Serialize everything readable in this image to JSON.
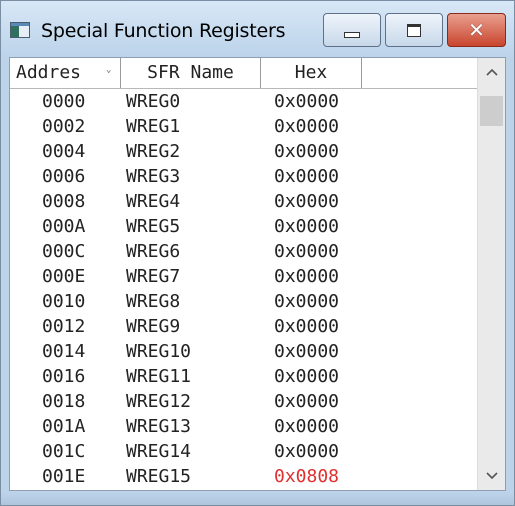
{
  "window": {
    "title": "Special Function Registers",
    "app_icon": "register-window-icon",
    "controls": {
      "minimize_icon": "minimize-icon",
      "maximize_icon": "maximize-icon",
      "close_icon": "close-icon",
      "close_glyph": "✕"
    }
  },
  "table": {
    "columns": {
      "address": "Addres",
      "sort_glyph": "⌄",
      "sfr_name": "SFR Name",
      "hex": "Hex"
    },
    "rows": [
      {
        "address": "0000",
        "name": "WREG0",
        "hex": "0x0000",
        "changed": false
      },
      {
        "address": "0002",
        "name": "WREG1",
        "hex": "0x0000",
        "changed": false
      },
      {
        "address": "0004",
        "name": "WREG2",
        "hex": "0x0000",
        "changed": false
      },
      {
        "address": "0006",
        "name": "WREG3",
        "hex": "0x0000",
        "changed": false
      },
      {
        "address": "0008",
        "name": "WREG4",
        "hex": "0x0000",
        "changed": false
      },
      {
        "address": "000A",
        "name": "WREG5",
        "hex": "0x0000",
        "changed": false
      },
      {
        "address": "000C",
        "name": "WREG6",
        "hex": "0x0000",
        "changed": false
      },
      {
        "address": "000E",
        "name": "WREG7",
        "hex": "0x0000",
        "changed": false
      },
      {
        "address": "0010",
        "name": "WREG8",
        "hex": "0x0000",
        "changed": false
      },
      {
        "address": "0012",
        "name": "WREG9",
        "hex": "0x0000",
        "changed": false
      },
      {
        "address": "0014",
        "name": "WREG10",
        "hex": "0x0000",
        "changed": false
      },
      {
        "address": "0016",
        "name": "WREG11",
        "hex": "0x0000",
        "changed": false
      },
      {
        "address": "0018",
        "name": "WREG12",
        "hex": "0x0000",
        "changed": false
      },
      {
        "address": "001A",
        "name": "WREG13",
        "hex": "0x0000",
        "changed": false
      },
      {
        "address": "001C",
        "name": "WREG14",
        "hex": "0x0000",
        "changed": false
      },
      {
        "address": "001E",
        "name": "WREG15",
        "hex": "0x0808",
        "changed": true
      }
    ],
    "changed_color": "#e03030"
  },
  "scrollbar": {
    "up_arrow": "^",
    "down_arrow": "v",
    "up_icon": "scroll-up-arrow-icon",
    "down_icon": "scroll-down-arrow-icon"
  }
}
